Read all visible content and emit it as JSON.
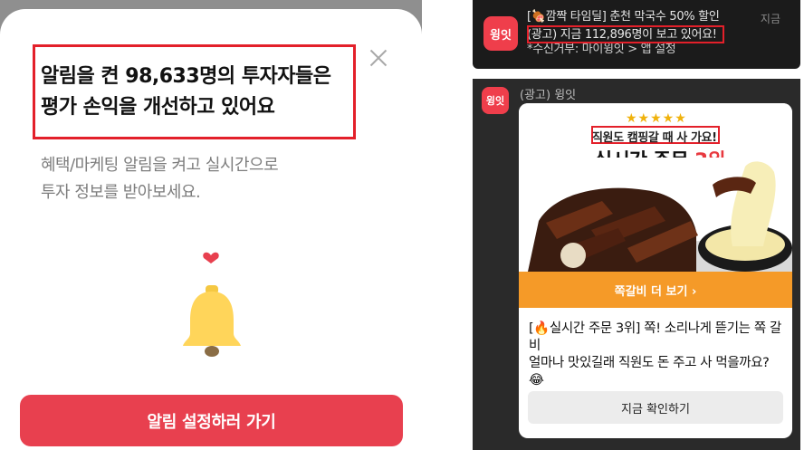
{
  "popup": {
    "headline_line1": "알림을 켠 98,633명의 투자자들은",
    "headline_line2": "평가 손익을 개선하고 있어요",
    "sub_line1": "혜택/마케팅 알림을 켜고 실시간으로",
    "sub_line2": "투자 정보를 받아보세요.",
    "cta_label": "알림 설정하러 가기",
    "close_icon": "close-icon",
    "illustration_icon": "bell-icon",
    "colors": {
      "cta": "#e8404f",
      "highlight_box": "#e3202a",
      "bell": "#ffd55a",
      "heart": "#e8404f"
    }
  },
  "push_notification": {
    "app_icon_label": "윙잇",
    "title": "[🍖깜짝 타임딜] 춘천 막국수 50% 할인",
    "line2": "(광고) 지금 112,896명이 보고 있어요!",
    "line3": "*수신거부: 마이윙잇 > 앱 설정",
    "time": "지금"
  },
  "rich_notification": {
    "app_icon_label": "윙잇",
    "sender": "(광고) 윙잇",
    "stars": "★★★★★",
    "banner_subtitle": "직원도 캠핑갈 때 사 가요!",
    "banner_title_prefix": "실시간 주문 ",
    "banner_title_rank": "3위",
    "more_label": "쪽갈비 더 보기 ›",
    "body_line1": "[🔥실시간 주문 3위] 쪽! 소리나게 뜯기는 쪽 갈비",
    "body_line2": "얼마나 맛있길래 직원도 돈 주고 사 먹을까요? 😂",
    "check_label": "지금 확인하기",
    "colors": {
      "accent": "#e8393f",
      "more_bar": "#f59a28",
      "stars": "#f0b20c"
    }
  }
}
